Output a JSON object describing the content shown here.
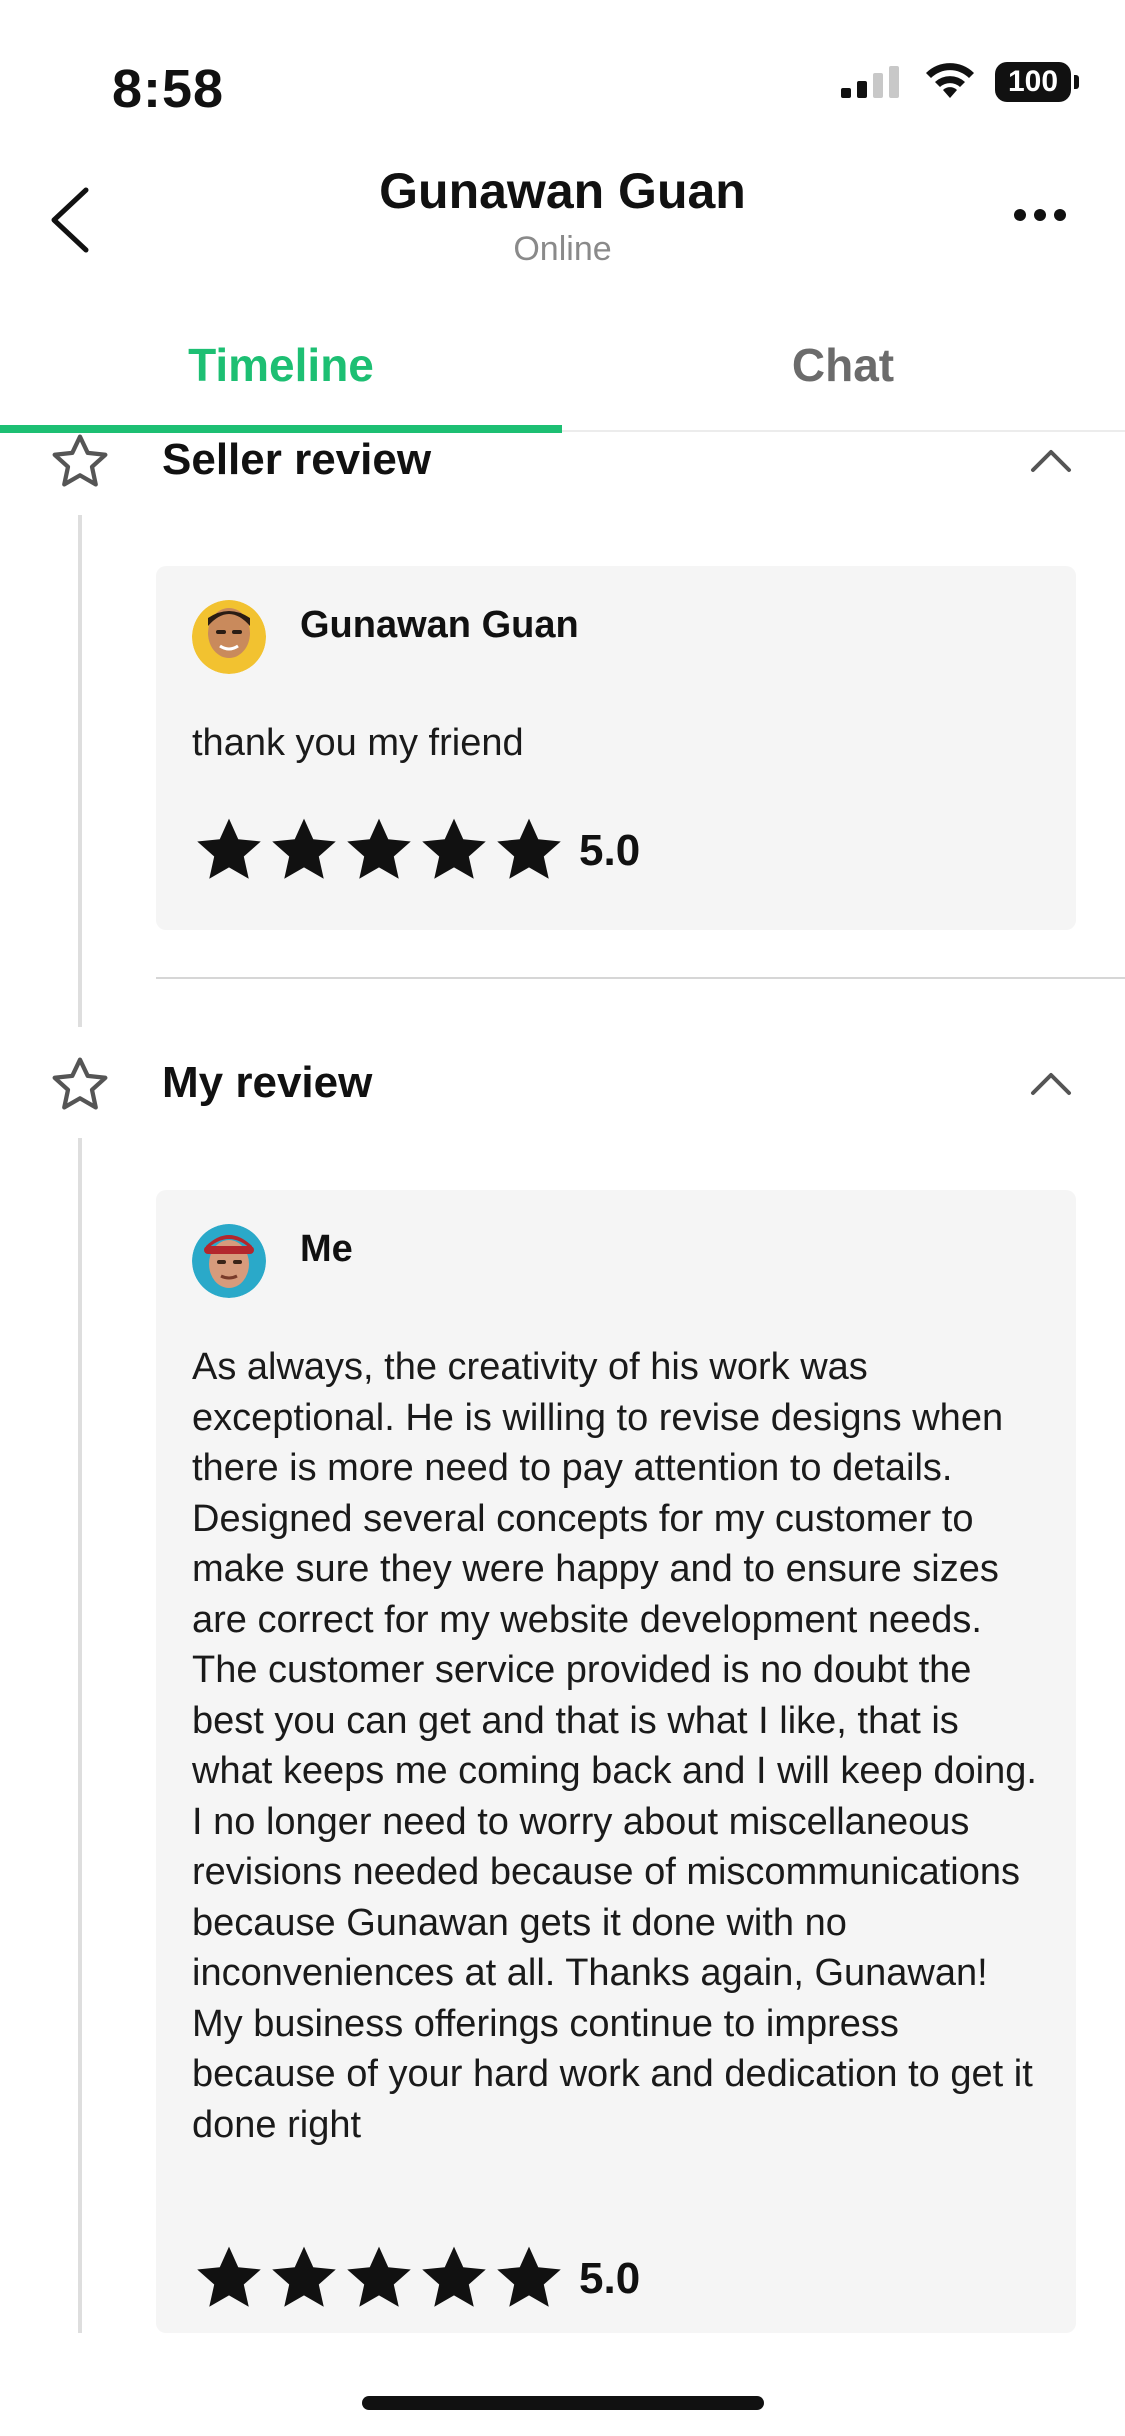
{
  "status_bar": {
    "time": "8:58",
    "battery": "100"
  },
  "header": {
    "contact_name": "Gunawan Guan",
    "contact_status": "Online"
  },
  "tabs": [
    {
      "label": "Timeline",
      "active": true
    },
    {
      "label": "Chat",
      "active": false
    }
  ],
  "sections": [
    {
      "title": "Seller review",
      "review": {
        "author": "Gunawan Guan",
        "text": "thank you my friend",
        "stars": 5,
        "rating": "5.0"
      }
    },
    {
      "title": "My review",
      "review": {
        "author": "Me",
        "text": "As always, the creativity of his work was exceptional. He is willing to revise designs when there is more need to pay attention to details. Designed several concepts for my customer to make sure they were happy and to ensure sizes are correct for my website development needs. The customer service provided is no doubt the best you can get and that is what I like, that is what keeps me coming back and I will keep doing. I no longer need to worry about miscellaneous revisions needed because of miscommunications because Gunawan gets it done with no inconveniences at all. Thanks again, Gunawan! My business offerings continue to impress because of your hard work and dedication to get it done right",
        "stars": 5,
        "rating": "5.0"
      }
    }
  ],
  "colors": {
    "accent": "#1dbf73",
    "card_bg": "#f5f5f5",
    "muted": "#8a8a8a"
  },
  "icons": [
    "back-arrow-icon",
    "more-options-icon",
    "star-outline-icon",
    "chevron-up-icon",
    "star-filled-icon"
  ]
}
